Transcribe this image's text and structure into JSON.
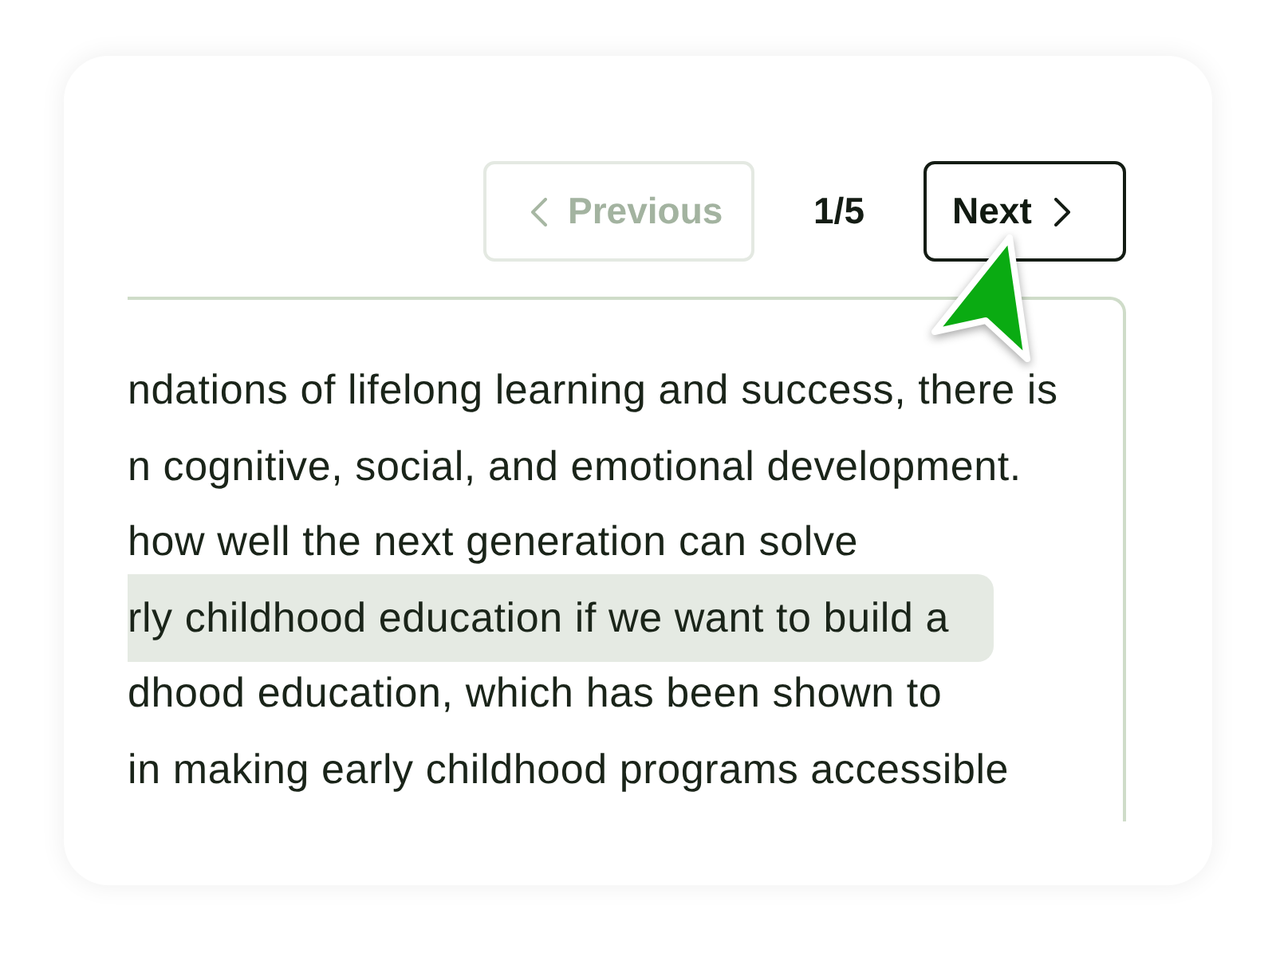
{
  "pagination": {
    "previous": {
      "label": "Previous",
      "disabled": true
    },
    "page_indicator": "1/5",
    "next": {
      "label": "Next",
      "disabled": false
    }
  },
  "text_panel": {
    "lines": [
      {
        "text": "ndations of lifelong learning and success, there is",
        "highlighted": false
      },
      {
        "text": "n cognitive, social, and emotional development.",
        "highlighted": false
      },
      {
        "text": "how well the next generation can solve",
        "highlighted": false
      },
      {
        "text": "rly childhood education if we want to build a",
        "highlighted": true
      },
      {
        "text": "dhood education, which has been shown to",
        "highlighted": false
      },
      {
        "text": "in making early childhood programs accessible",
        "highlighted": false
      }
    ]
  }
}
